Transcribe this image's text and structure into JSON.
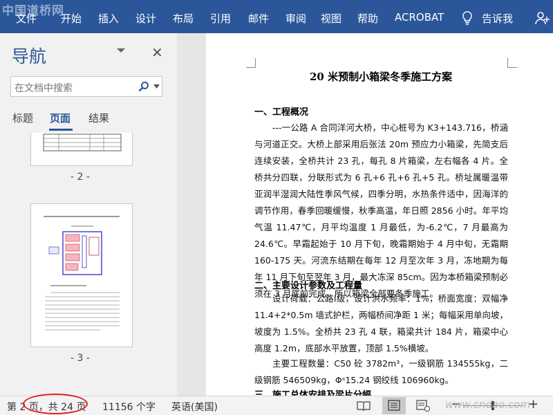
{
  "watermark": "中国道桥网",
  "ribbon": {
    "tabs": [
      "文件",
      "开始",
      "插入",
      "设计",
      "布局",
      "引用",
      "邮件",
      "审阅",
      "视图",
      "帮助",
      "ACROBAT"
    ],
    "tell_me": "告诉我"
  },
  "nav": {
    "title": "导航",
    "search_placeholder": "在文档中搜索",
    "tabs": [
      "标题",
      "页面",
      "结果"
    ],
    "active_tab": "页面",
    "page_labels": [
      "- 2 -",
      "- 3 -"
    ]
  },
  "document": {
    "title": "20 米预制小箱梁冬季施工方案",
    "section1_heading": "一、工程概况",
    "section1_para": "---一公路 A 合同洋河大桥，中心桩号为 K3+143.716，桥涵与河道正交。大桥上部采用后张法 20m 预应力小箱梁，先简支后连续安装，全桥共计 23 孔，每孔 8 片箱梁，左右幅各 4 片。全桥共分四联，分联形式为 6 孔+6 孔+6 孔+5 孔。桥址属暖温带亚润半湿润大陆性季风气候，四季分明，水热条件适中，因海洋的调节作用，春季回暖缓慢，秋季高温，年日照 2856 小时。年平均气温 11.47℃，月平均温度 1 月最低，为-6.2℃，7 月最高为 24.6℃。早霜起始于 10 月下旬，晚霜期始于 4 月中旬，无霜期 160-175 天。河流东结期在每年 12 月至次年 3 月，冻地期为每年 11 月下旬至翌年 3 月，最大冻深 85cm。因为本桥箱梁预制必须在 3 月底前完成，所以箱梁全部要冬季施工。",
    "section2_heading": "二、主要设计参数及工程量",
    "section2_para1": "设计荷载：公路Ⅰ级，设计洪水频率：1%，桥面宽度：双幅净 11.4+2*0.5m 墙式护栏，两幅桥间净距 1 米；每幅采用单向坡，坡度为 1.5%。全桥共 23 孔 4 联，箱梁共计 184 片，箱梁中心高度 1.2m，底部水平放置，顶部 1.5%横坡。",
    "section2_para2": "主要工程数量：C50 砼 3782m³，一级钢筋 134555kg，二级钢筋 546509kg，Φˢ15.24 钢绞线 106960kg。",
    "section3_heading": "三、施工总体安排及梁片分幅"
  },
  "status": {
    "page": "第 2 页，共 24 页",
    "words": "11156 个字",
    "language": "英语(美国)"
  },
  "site_watermark": "www.cndao.com",
  "colors": {
    "ribbon": "#2b579a",
    "nav_bg": "#f1f1f1",
    "accent": "#2b579a",
    "highlight": "#e02020"
  }
}
